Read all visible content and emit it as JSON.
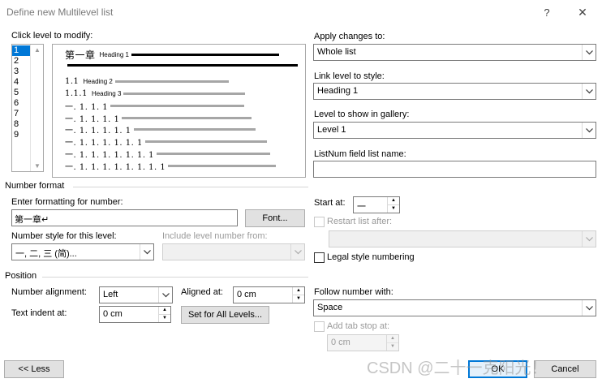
{
  "dialog": {
    "title": "Define new Multilevel list",
    "help_glyph": "?",
    "close_glyph": "✕"
  },
  "level_picker": {
    "label": "Click level to modify:",
    "levels": [
      "1",
      "2",
      "3",
      "4",
      "5",
      "6",
      "7",
      "8",
      "9"
    ],
    "selected": "1"
  },
  "preview": {
    "rows": [
      {
        "num": "第一章",
        "heading": "Heading 1"
      },
      {
        "num": "",
        "heading": ""
      },
      {
        "num": "1.1",
        "heading": "Heading 2"
      },
      {
        "num": "1.1.1",
        "heading": "Heading 3"
      },
      {
        "num": "一. 1. 1. 1",
        "heading": ""
      },
      {
        "num": "一. 1. 1. 1. 1",
        "heading": ""
      },
      {
        "num": "一. 1. 1. 1. 1. 1",
        "heading": ""
      },
      {
        "num": "一. 1. 1. 1. 1. 1. 1",
        "heading": ""
      },
      {
        "num": "一. 1. 1. 1. 1. 1. 1. 1",
        "heading": ""
      },
      {
        "num": "一. 1. 1. 1. 1. 1. 1. 1. 1",
        "heading": ""
      }
    ]
  },
  "apply_changes": {
    "label": "Apply changes to:",
    "value": "Whole list"
  },
  "link_level": {
    "label": "Link level to style:",
    "value": "Heading 1"
  },
  "level_gallery": {
    "label": "Level to show in gallery:",
    "value": "Level 1"
  },
  "listnum": {
    "label": "ListNum field list name:",
    "value": ""
  },
  "number_format": {
    "section": "Number format",
    "enter_label": "Enter formatting for number:",
    "format_value": "第一章↵",
    "font_button": "Font...",
    "style_label": "Number style for this level:",
    "style_value": "一, 二, 三 (简)...",
    "include_label": "Include level number from:",
    "include_value": ""
  },
  "start_at": {
    "label": "Start at:",
    "value": "一"
  },
  "restart": {
    "label": "Restart list after:",
    "value": ""
  },
  "legal": {
    "label": "Legal style numbering"
  },
  "position": {
    "section": "Position",
    "alignment_label": "Number alignment:",
    "alignment_value": "Left",
    "aligned_at_label": "Aligned at:",
    "aligned_at_value": "0 cm",
    "indent_label": "Text indent at:",
    "indent_value": "0 cm",
    "set_all_button": "Set for All Levels..."
  },
  "follow": {
    "label": "Follow number with:",
    "value": "Space"
  },
  "tab_stop": {
    "label": "Add tab stop at:",
    "value": "0 cm"
  },
  "footer": {
    "less_button": "<< Less",
    "ok_button": "OK",
    "cancel_button": "Cancel"
  },
  "watermark": "CSDN @二十一克阳光！",
  "colors": {
    "accent": "#0078d7",
    "disabled_text": "#9a9a9a"
  }
}
